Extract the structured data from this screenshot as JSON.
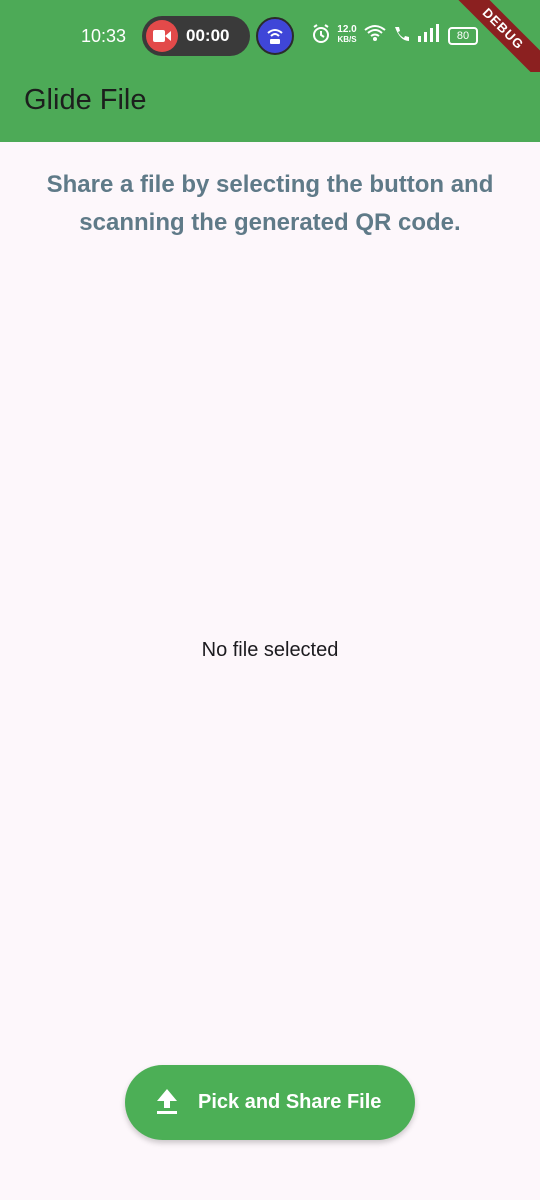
{
  "status_bar": {
    "time": "10:33",
    "recording_timer": "00:00",
    "net_speed_value": "12.0",
    "net_speed_unit": "KB/S",
    "battery": "80",
    "debug_banner": "DEBUG"
  },
  "app_bar": {
    "title": "Glide File"
  },
  "main": {
    "intro_text": "Share a file by selecting the button and scanning the generated QR code.",
    "status_text": "No file selected"
  },
  "fab": {
    "label": "Pick and Share File",
    "icon": "upload-icon"
  },
  "colors": {
    "primary": "#4daa57",
    "background": "#fdf7fb",
    "intro_text": "#5f7a88",
    "fab": "#4caf56",
    "debug_banner": "#8b2020"
  }
}
